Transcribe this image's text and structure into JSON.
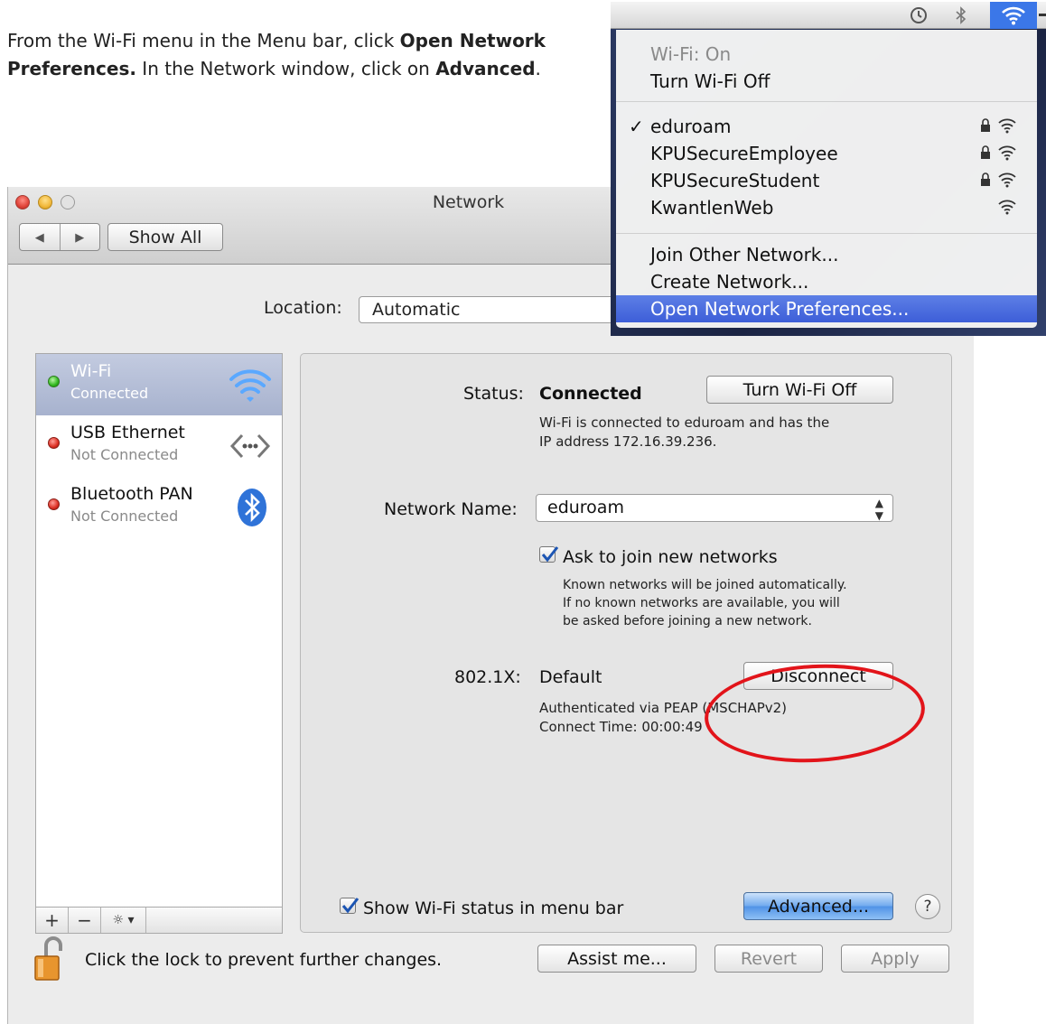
{
  "instructions": {
    "part1": "From the Wi-Fi menu in the Menu bar, click ",
    "bold1": "Open Network Preferences.",
    "part2": " In the Network window, click on ",
    "bold2": "Advanced",
    "part3": "."
  },
  "window": {
    "title": "Network",
    "show_all": "Show All",
    "location_label": "Location:",
    "location_value": "Automatic"
  },
  "sidebar": {
    "items": [
      {
        "name": "Wi-Fi",
        "status": "Connected",
        "icon": "wifi-icon",
        "selected": true
      },
      {
        "name": "USB Ethernet",
        "status": "Not Connected",
        "icon": "ethernet-icon",
        "selected": false
      },
      {
        "name": "Bluetooth PAN",
        "status": "Not Connected",
        "icon": "bluetooth-icon",
        "selected": false
      }
    ],
    "toolbar": {
      "add": "+",
      "remove": "−",
      "action": "☼ ▾"
    }
  },
  "detail": {
    "status_label": "Status:",
    "status_value": "Connected",
    "turn_off": "Turn Wi-Fi Off",
    "status_desc_1": "Wi-Fi is connected to eduroam and has the",
    "status_desc_2": "IP address 172.16.39.236.",
    "network_name_label": "Network Name:",
    "network_name_value": "eduroam",
    "ask_join": "Ask to join new networks",
    "ask_desc_1": "Known networks will be joined automatically.",
    "ask_desc_2": "If no known networks are available, you will",
    "ask_desc_3": "be asked before joining a new network.",
    "dot1x_label": "802.1X:",
    "dot1x_value": "Default",
    "disconnect": "Disconnect",
    "auth_1": "Authenticated via PEAP (MSCHAPv2)",
    "auth_2": "Connect Time: 00:00:49",
    "show_status": "Show Wi-Fi status in menu bar",
    "advanced": "Advanced...",
    "help": "?"
  },
  "footer": {
    "lock_text": "Click the lock to prevent further changes.",
    "assist": "Assist me...",
    "revert": "Revert",
    "apply": "Apply"
  },
  "wifi_menu": {
    "status": "Wi-Fi: On",
    "turn_off": "Turn Wi-Fi Off",
    "networks": [
      {
        "name": "eduroam",
        "locked": true,
        "checked": true
      },
      {
        "name": "KPUSecureEmployee",
        "locked": true,
        "checked": false
      },
      {
        "name": "KPUSecureStudent",
        "locked": true,
        "checked": false
      },
      {
        "name": "KwantlenWeb",
        "locked": false,
        "checked": false
      }
    ],
    "join_other": "Join Other Network...",
    "create": "Create Network...",
    "open_prefs": "Open Network Preferences..."
  },
  "colors": {
    "highlight_blue": "#3d5ed8",
    "annotation_red": "#e2141a",
    "selected_row": "#a7b2ce"
  }
}
